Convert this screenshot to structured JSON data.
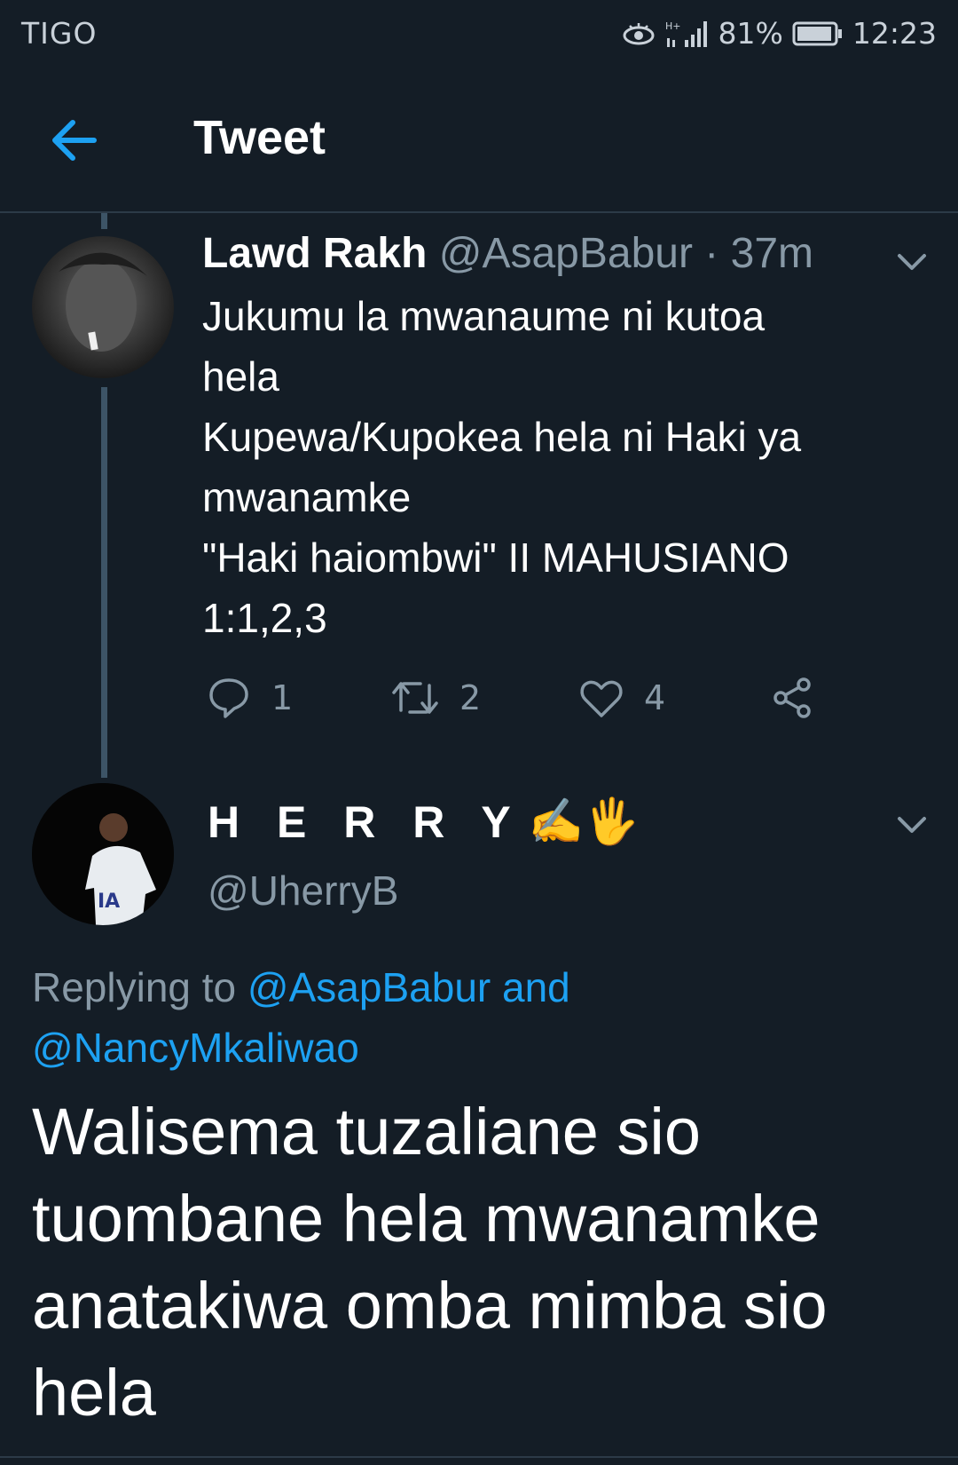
{
  "status_bar": {
    "carrier": "TIGO",
    "network": "H+",
    "battery": "81%",
    "time": "12:23",
    "icons": [
      "eye-icon",
      "signal-icon",
      "battery-icon"
    ]
  },
  "header": {
    "title": "Tweet",
    "back_icon": "arrow-left-icon"
  },
  "original_tweet": {
    "name": "Lawd Rakh",
    "handle": "@AsapBabur",
    "separator": "·",
    "time": "37m",
    "lines": [
      "Jukumu la mwanaume ni kutoa",
      "hela",
      "Kupewa/Kupokea hela ni Haki ya",
      "mwanamke",
      "\"Haki haiombwi\" II MAHUSIANO",
      "1:1,2,3"
    ],
    "actions": {
      "replies": "1",
      "retweets": "2",
      "likes": "4"
    }
  },
  "reply_tweet": {
    "name": "H E R R Y",
    "name_emoji": "✍🖐",
    "handle": "@UherryB",
    "replying_prefix": "Replying to",
    "replying_link1": "@AsapBabur and",
    "replying_link2": "@NancyMkaliwao",
    "text_lines": [
      "Walisema tuzaliane sio",
      "tuombane hela mwanamke",
      "anatakiwa omba mimba sio",
      "hela"
    ]
  },
  "colors": {
    "background": "#141d26",
    "accent": "#1da1f2",
    "secondary_text": "#8899a6",
    "divider": "#2c3a47"
  }
}
